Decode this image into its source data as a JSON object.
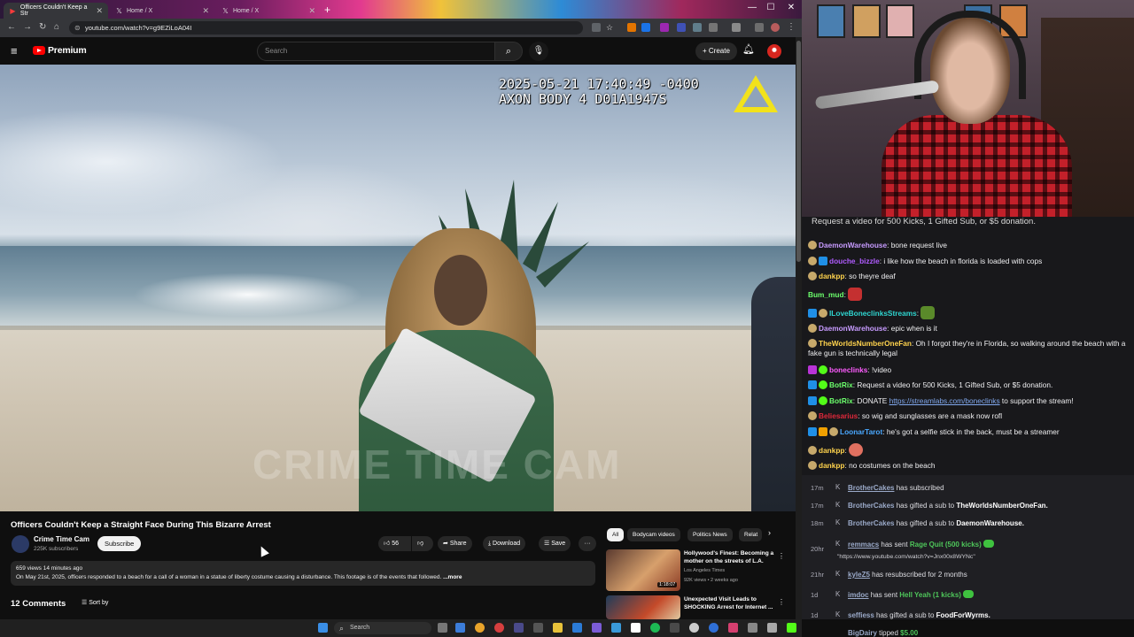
{
  "browser": {
    "tabs": [
      {
        "title": "Officers Couldn't Keep a Str",
        "icon": "youtube-icon",
        "active": true
      },
      {
        "title": "Home / X",
        "icon": "x-icon",
        "active": false
      },
      {
        "title": "Home / X",
        "icon": "x-icon",
        "active": false
      }
    ],
    "url": "youtube.com/watch?v=g9EZiLoA04I"
  },
  "youtube": {
    "brand": "Premium",
    "search_placeholder": "Search",
    "create_label": "Create",
    "video": {
      "timestamp_line1": "2025-05-21 17:40:49 -0400",
      "timestamp_line2": "AXON BODY 4 D01A1947S",
      "watermark": "CRIME TIME CAM"
    },
    "title": "Officers Couldn't Keep a Straight Face During This Bizarre Arrest",
    "channel": {
      "name": "Crime Time Cam",
      "subscribers": "225K subscribers",
      "subscribe_label": "Subscribe"
    },
    "actions": {
      "likes": "56",
      "share": "Share",
      "download": "Download",
      "save": "Save"
    },
    "description": {
      "meta": "659 views  14 minutes ago",
      "text": "On May 21st, 2025, officers responded to a beach for a call of a woman in a statue of liberty costume causing a disturbance.  This footage is of the events that followed.",
      "more": "...more"
    },
    "comments": {
      "count": "12 Comments",
      "sort_label": "Sort by"
    },
    "chips": [
      "All",
      "Bodycam videos",
      "Politics News",
      "Relat"
    ],
    "recommendations": [
      {
        "title": "Hollywood's Finest: Becoming a mother on the streets of L.A.",
        "channel": "Los Angeles Times",
        "meta": "92K views • 2 weeks ago",
        "duration": "1:18:07"
      },
      {
        "title": "Unexpected Visit Leads to SHOCKING Arrest for Internet ...",
        "channel": "",
        "meta": "",
        "duration": ""
      }
    ]
  },
  "chat": {
    "cut_text": "Request a video for 500 Kicks, 1 Gifted Sub, or $5 donation.",
    "messages": [
      {
        "user": "DaemonWarehouse",
        "text": "bone request live",
        "color": "#c79bff"
      },
      {
        "user": "douche_bizzle",
        "text": "i like how the beach in florida is loaded with cops",
        "color": "#b05cff"
      },
      {
        "user": "dankpp",
        "text": "so theyre deaf",
        "color": "#ffd34d"
      },
      {
        "user": "Bum_mud",
        "text": "",
        "color": "#6cff6c"
      },
      {
        "user": "ILoveBoneclinksStreams",
        "text": "",
        "color": "#2fd5d0"
      },
      {
        "user": "DaemonWarehouse",
        "text": "epic when is it",
        "color": "#c79bff"
      },
      {
        "user": "TheWorldsNumberOneFan",
        "text": "Oh I forgot they're in Florida, so walking around the beach with a fake gun is technically legal",
        "color": "#ffd34d"
      },
      {
        "user": "boneclinks",
        "text": "!video",
        "color": "#ff5cff"
      },
      {
        "user": "BotRix",
        "text": "Request a video for 500 Kicks, 1 Gifted Sub, or $5 donation.",
        "color": "#6cff6c"
      },
      {
        "user": "BotRix",
        "text_before": "DONATE ",
        "link": "https://streamlabs.com/boneclinks",
        "text_after": " to support the stream!",
        "color": "#6cff6c"
      },
      {
        "user": "Beliesarius",
        "text": "so wig and sunglasses are a mask now rofl",
        "color": "#e0283a"
      },
      {
        "user": "LoonarTarot",
        "text": "he's got a selfie stick in the back, must be a streamer",
        "color": "#4aa8ff"
      },
      {
        "user": "dankpp",
        "text": "",
        "color": "#ffd34d"
      },
      {
        "user": "dankpp",
        "text": "no costumes on the beach",
        "color": "#ffd34d"
      }
    ]
  },
  "events": [
    {
      "time": "17m",
      "user": "BrotherCakes",
      "text": "has subscribed"
    },
    {
      "time": "17m",
      "user": "BrotherCakes",
      "text": "has gifted a sub to",
      "target": "TheWorldsNumberOneFan."
    },
    {
      "time": "18m",
      "user": "BrotherCakes",
      "text": "has gifted a sub to",
      "target": "DaemonWarehouse."
    },
    {
      "time": "20hr",
      "user": "remmacs",
      "text": "has sent",
      "item": "Rage Quit (500 kicks)",
      "sub": "\"https://www.youtube.com/watch?v=Jnx00x8WYNc\""
    },
    {
      "time": "21hr",
      "user": "kyleZ5",
      "text": "has resubscribed for 2 months"
    },
    {
      "time": "1d",
      "user": "imdoc",
      "text": "has sent",
      "item": "Hell Yeah (1 kicks)"
    },
    {
      "time": "1d",
      "user": "seffiess",
      "text": "has gifted a sub to",
      "target": "FoodForWyrms."
    },
    {
      "time": "",
      "user": "BigDairy",
      "text": "tipped",
      "item": "$5.00"
    }
  ],
  "taskbar": {
    "search_label": "Search"
  },
  "colors": {
    "youtube_red": "#ff0000",
    "chat_bg": "#18181b",
    "kick_green": "#53fc18"
  }
}
